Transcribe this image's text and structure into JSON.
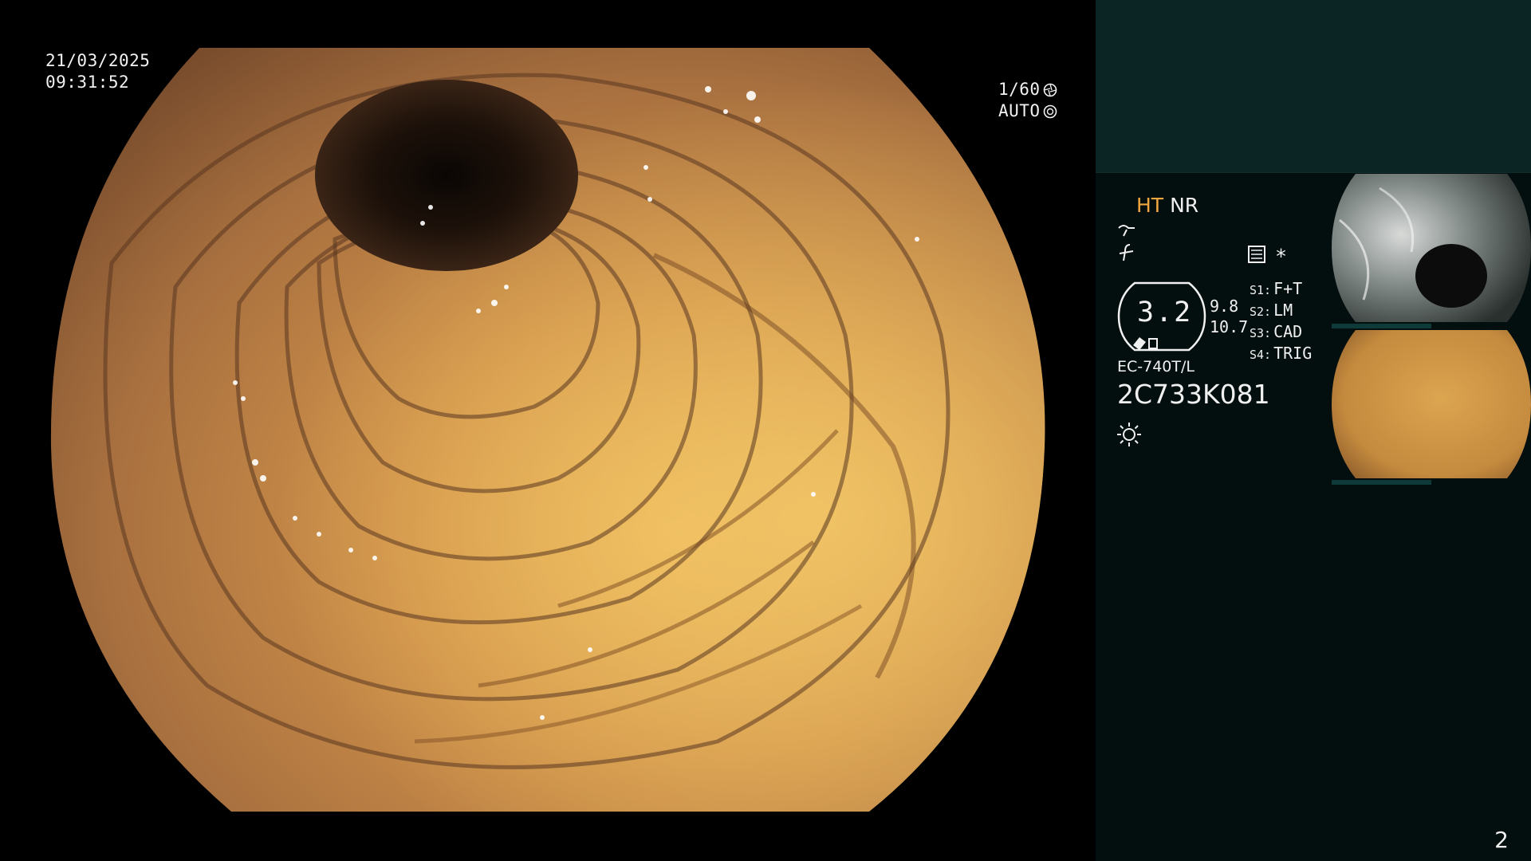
{
  "overlay": {
    "date": "21/03/2025",
    "time": "09:31:52",
    "shutter_speed": "1/60",
    "iris_mode": "AUTO"
  },
  "sidebar": {
    "mode_ht": "HT",
    "mode_nr": "NR",
    "zoom_value": "3.2",
    "zoom_sub_1": "9.8",
    "zoom_sub_2": "10.7",
    "star": "*",
    "switches": [
      {
        "key": "S1:",
        "value": "F+T"
      },
      {
        "key": "S2:",
        "value": "LM"
      },
      {
        "key": "S3:",
        "value": "CAD"
      },
      {
        "key": "S4:",
        "value": "TRIG"
      }
    ],
    "scope_model": "EC-740T/L",
    "scope_serial": "2C733K081",
    "page_number": "2"
  },
  "theme": {
    "sidebar_bg": "#030f0f",
    "sidebar_top_bg": "#0b2424",
    "accent_orange": "#f2a640"
  },
  "icons": {
    "a": "curve-icon",
    "b": "enhance-icon",
    "brightness": "sun-icon",
    "menu": "menu-list-icon",
    "shutter": "shutter-icon",
    "iris": "iris-icon"
  }
}
